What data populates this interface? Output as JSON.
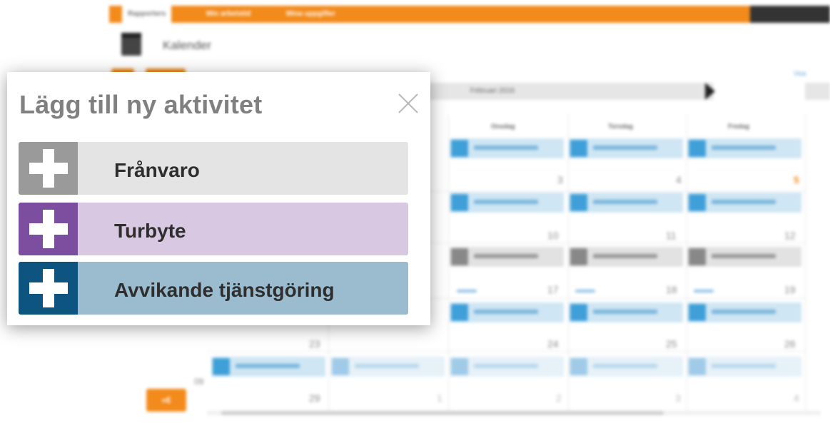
{
  "background": {
    "nav_tabs": [
      "Rapporters",
      "Min arbetstid",
      "Mina uppgifter"
    ],
    "user_box": "",
    "page_title": "Kalender",
    "month_label": "Februari 2016",
    "link_text": "Visa",
    "day_headers": [
      "Onsdag",
      "Torsdag",
      "Fredag"
    ],
    "day_numbers": {
      "row1": [
        "3",
        "4",
        "5"
      ],
      "row2": [
        "10",
        "11",
        "12"
      ],
      "row3": [
        "17",
        "18",
        "19"
      ],
      "row4": [
        "23",
        "24",
        "25",
        "26"
      ],
      "row5": [
        "29",
        "1",
        "2",
        "3",
        "4"
      ]
    },
    "week_number": "09",
    "back_button": "«€"
  },
  "modal": {
    "title": "Lägg till ny aktivitet",
    "options": [
      {
        "label": "Frånvaro",
        "accent": "#9a9a9a",
        "fill": "#e4e4e4",
        "icon": "plus-icon"
      },
      {
        "label": "Turbyte",
        "accent": "#7b4ea0",
        "fill": "#d9c8e1",
        "icon": "plus-icon"
      },
      {
        "label": "Avvikande tjänstgöring",
        "accent": "#0d5580",
        "fill": "#9bbccf",
        "icon": "plus-icon"
      }
    ],
    "close_icon": "close-icon"
  }
}
